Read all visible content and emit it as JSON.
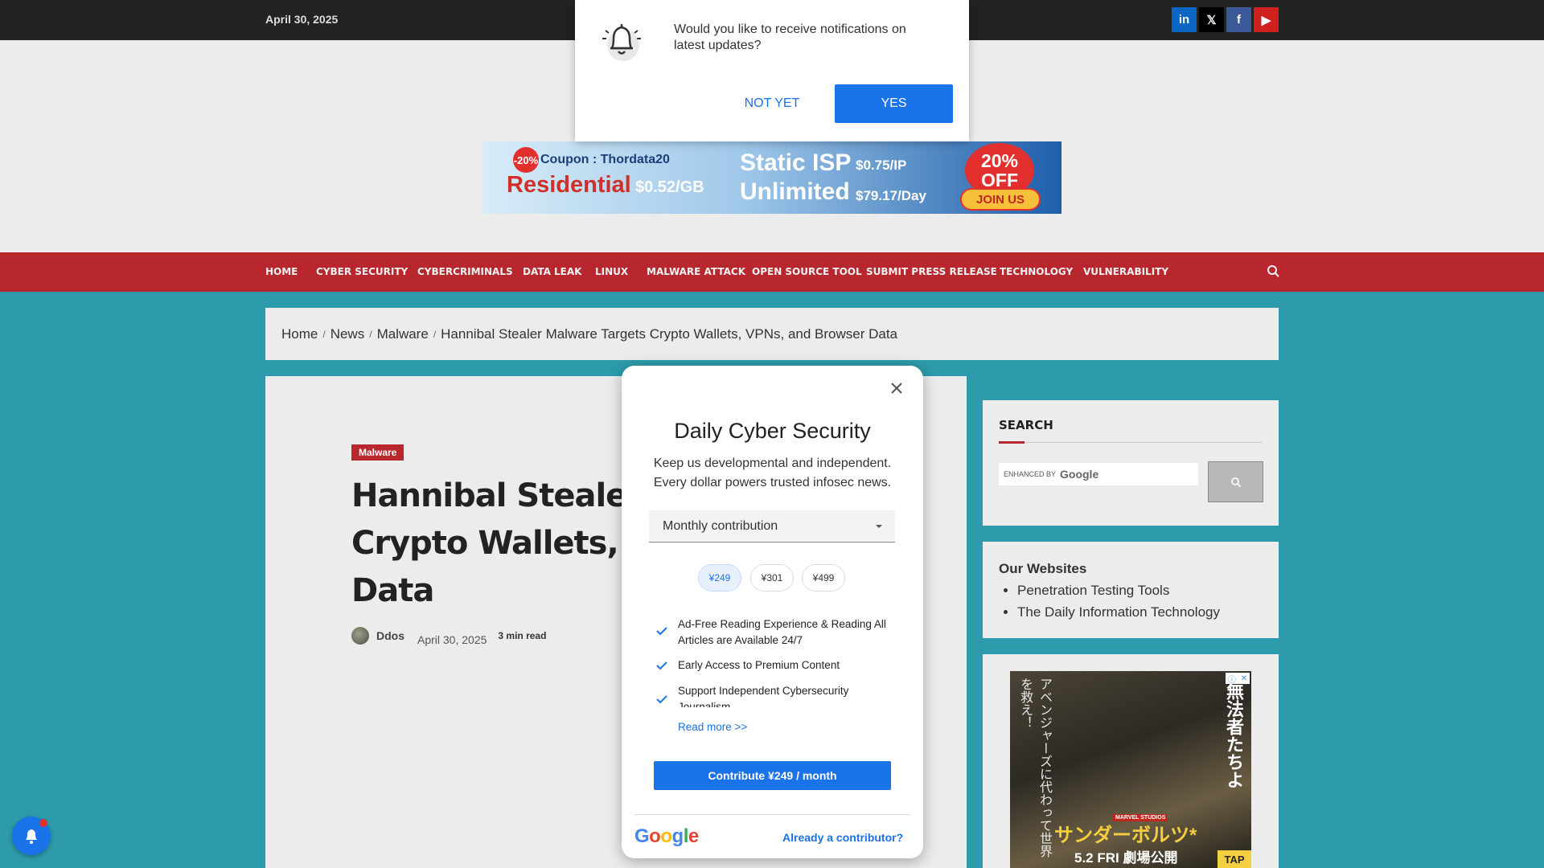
{
  "topbar": {
    "date": "April 30, 2025",
    "social": [
      {
        "name": "linkedin",
        "glyph": "in"
      },
      {
        "name": "x",
        "glyph": "𝕏"
      },
      {
        "name": "facebook",
        "glyph": "f"
      },
      {
        "name": "youtube",
        "glyph": "▶"
      }
    ]
  },
  "banner": {
    "badge": "-20%",
    "coupon": "Coupon : Thordata20",
    "residential": "Residential",
    "residential_price": "$0.52/GB",
    "static_isp": "Static ISP",
    "static_isp_price": "$0.75/IP",
    "unlimited": "Unlimited",
    "unlimited_price": "$79.17/Day",
    "off": "20% OFF",
    "join": "JOIN US"
  },
  "nav": {
    "items": [
      "HOME",
      "CYBER SECURITY",
      "CYBERCRIMINALS",
      "DATA LEAK",
      "LINUX",
      "MALWARE ATTACK",
      "OPEN SOURCE TOOL",
      "SUBMIT PRESS RELEASE",
      "TECHNOLOGY",
      "VULNERABILITY"
    ]
  },
  "breadcrumb": {
    "items": [
      "Home",
      "News",
      "Malware",
      "Hannibal Stealer Malware Targets Crypto Wallets, VPNs, and Browser Data"
    ],
    "sep": "/"
  },
  "article": {
    "category": "Malware",
    "headline_lines": [
      "Hannibal Stealer Ma",
      "Crypto Wallets, VPN",
      "Data"
    ],
    "author": "Ddos",
    "date": "April 30, 2025",
    "read_time": "3 min read"
  },
  "sidebar": {
    "search_title": "SEARCH",
    "enhanced_by": "ENHANCED BY",
    "google": "Google",
    "sites_title": "Our Websites",
    "sites": [
      "Penetration Testing Tools",
      "The Daily Information Technology"
    ],
    "ad": {
      "vertical_right": "無法者たちよ",
      "vertical_left": "アベンジャーズに代わって世界を救え！",
      "title": "サンダーボルツ*",
      "date": "5.2 FRI 劇場公開",
      "studio": "MARVEL STUDIOS",
      "tap": "TAP"
    }
  },
  "notify": {
    "message": "Would you like to receive notifications on latest updates?",
    "not_yet": "NOT YET",
    "yes": "YES"
  },
  "dialog": {
    "title": "Daily Cyber Security",
    "subtitle": "Keep us developmental and independent. Every dollar powers trusted infosec news.",
    "select_value": "Monthly contribution",
    "amounts": [
      "¥249",
      "¥301",
      "¥499"
    ],
    "selected_amount": "¥249",
    "benefits": [
      "Ad-Free Reading Experience & Reading All Articles are Available 24/7",
      "Early Access to Premium Content",
      "Support Independent Cybersecurity Journalism"
    ],
    "read_more": "Read more >>",
    "contribute": "Contribute ¥249 / month",
    "google": "Google",
    "already": "Already a contributor?"
  },
  "colors": {
    "brand_red": "#b8272e",
    "accent_blue": "#1a73e8",
    "page_teal": "#2d9bab"
  }
}
